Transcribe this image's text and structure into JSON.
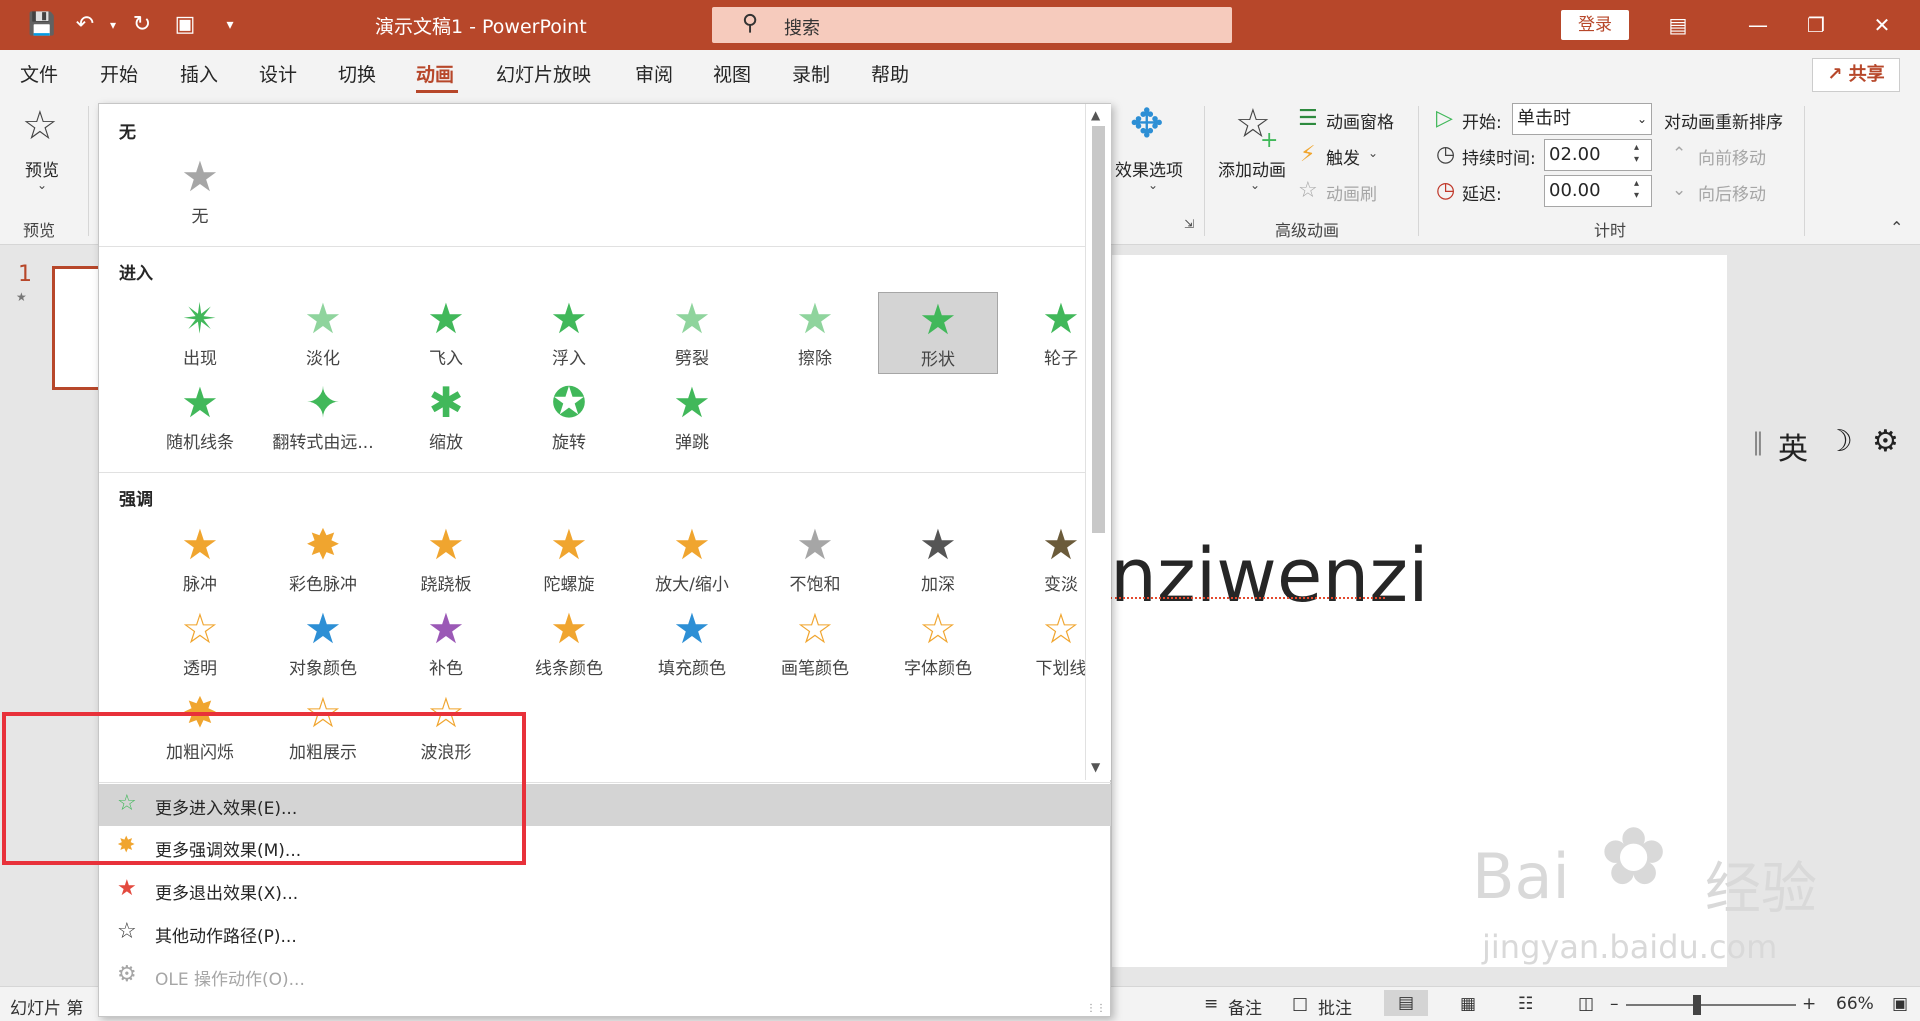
{
  "titlebar": {
    "doc_title": "演示文稿1  -  PowerPoint",
    "search_placeholder": "搜索",
    "login": "登录"
  },
  "tabs": [
    "文件",
    "开始",
    "插入",
    "设计",
    "切换",
    "动画",
    "幻灯片放映",
    "审阅",
    "视图",
    "录制",
    "帮助"
  ],
  "active_tab": "动画",
  "share": "共享",
  "ribbon": {
    "preview_label": "预览",
    "preview_group": "预览",
    "effect_options": "效果选项",
    "add_animation": "添加动画",
    "animation_pane": "动画窗格",
    "trigger": "触发",
    "animation_painter": "动画刷",
    "advanced_group": "高级动画",
    "start_label": "开始:",
    "start_value": "单击时",
    "duration_label": "持续时间:",
    "duration_value": "02.00",
    "delay_label": "延迟:",
    "delay_value": "00.00",
    "timing_group": "计时",
    "reorder_title": "对动画重新排序",
    "move_earlier": "向前移动",
    "move_later": "向后移动"
  },
  "thumb_number": "1",
  "slide_text": "nziwenzi",
  "ime": {
    "lang": "英"
  },
  "watermark": {
    "brand": "Bai",
    "cn": "经验",
    "url": "jingyan.baidu.com"
  },
  "status": {
    "slide_info": "幻灯片 第",
    "notes": "备注",
    "comments": "批注",
    "zoom": "66%"
  },
  "gallery": {
    "none_header": "无",
    "none_label": "无",
    "entrance_header": "进入",
    "entrance": [
      {
        "label": "出现"
      },
      {
        "label": "淡化"
      },
      {
        "label": "飞入"
      },
      {
        "label": "浮入"
      },
      {
        "label": "劈裂"
      },
      {
        "label": "擦除"
      },
      {
        "label": "形状"
      },
      {
        "label": "轮子"
      },
      {
        "label": "随机线条"
      },
      {
        "label": "翻转式由远..."
      },
      {
        "label": "缩放"
      },
      {
        "label": "旋转"
      },
      {
        "label": "弹跳"
      }
    ],
    "emphasis_header": "强调",
    "emphasis": [
      {
        "label": "脉冲"
      },
      {
        "label": "彩色脉冲"
      },
      {
        "label": "跷跷板"
      },
      {
        "label": "陀螺旋"
      },
      {
        "label": "放大/缩小"
      },
      {
        "label": "不饱和"
      },
      {
        "label": "加深"
      },
      {
        "label": "变淡"
      },
      {
        "label": "透明"
      },
      {
        "label": "对象颜色"
      },
      {
        "label": "补色"
      },
      {
        "label": "线条颜色"
      },
      {
        "label": "填充颜色"
      },
      {
        "label": "画笔颜色"
      },
      {
        "label": "字体颜色"
      },
      {
        "label": "下划线"
      },
      {
        "label": "加粗闪烁"
      },
      {
        "label": "加粗展示"
      },
      {
        "label": "波浪形"
      }
    ],
    "more": [
      {
        "label": "更多进入效果(E)..."
      },
      {
        "label": "更多强调效果(M)..."
      },
      {
        "label": "更多退出效果(X)..."
      },
      {
        "label": "其他动作路径(P)..."
      },
      {
        "label": "OLE 操作动作(O)..."
      }
    ]
  },
  "colors": {
    "accent": "#b7472a",
    "entrance_star": "#41b85a",
    "emphasis_star": "#f0a52f",
    "highlight_box": "#e8313a"
  }
}
